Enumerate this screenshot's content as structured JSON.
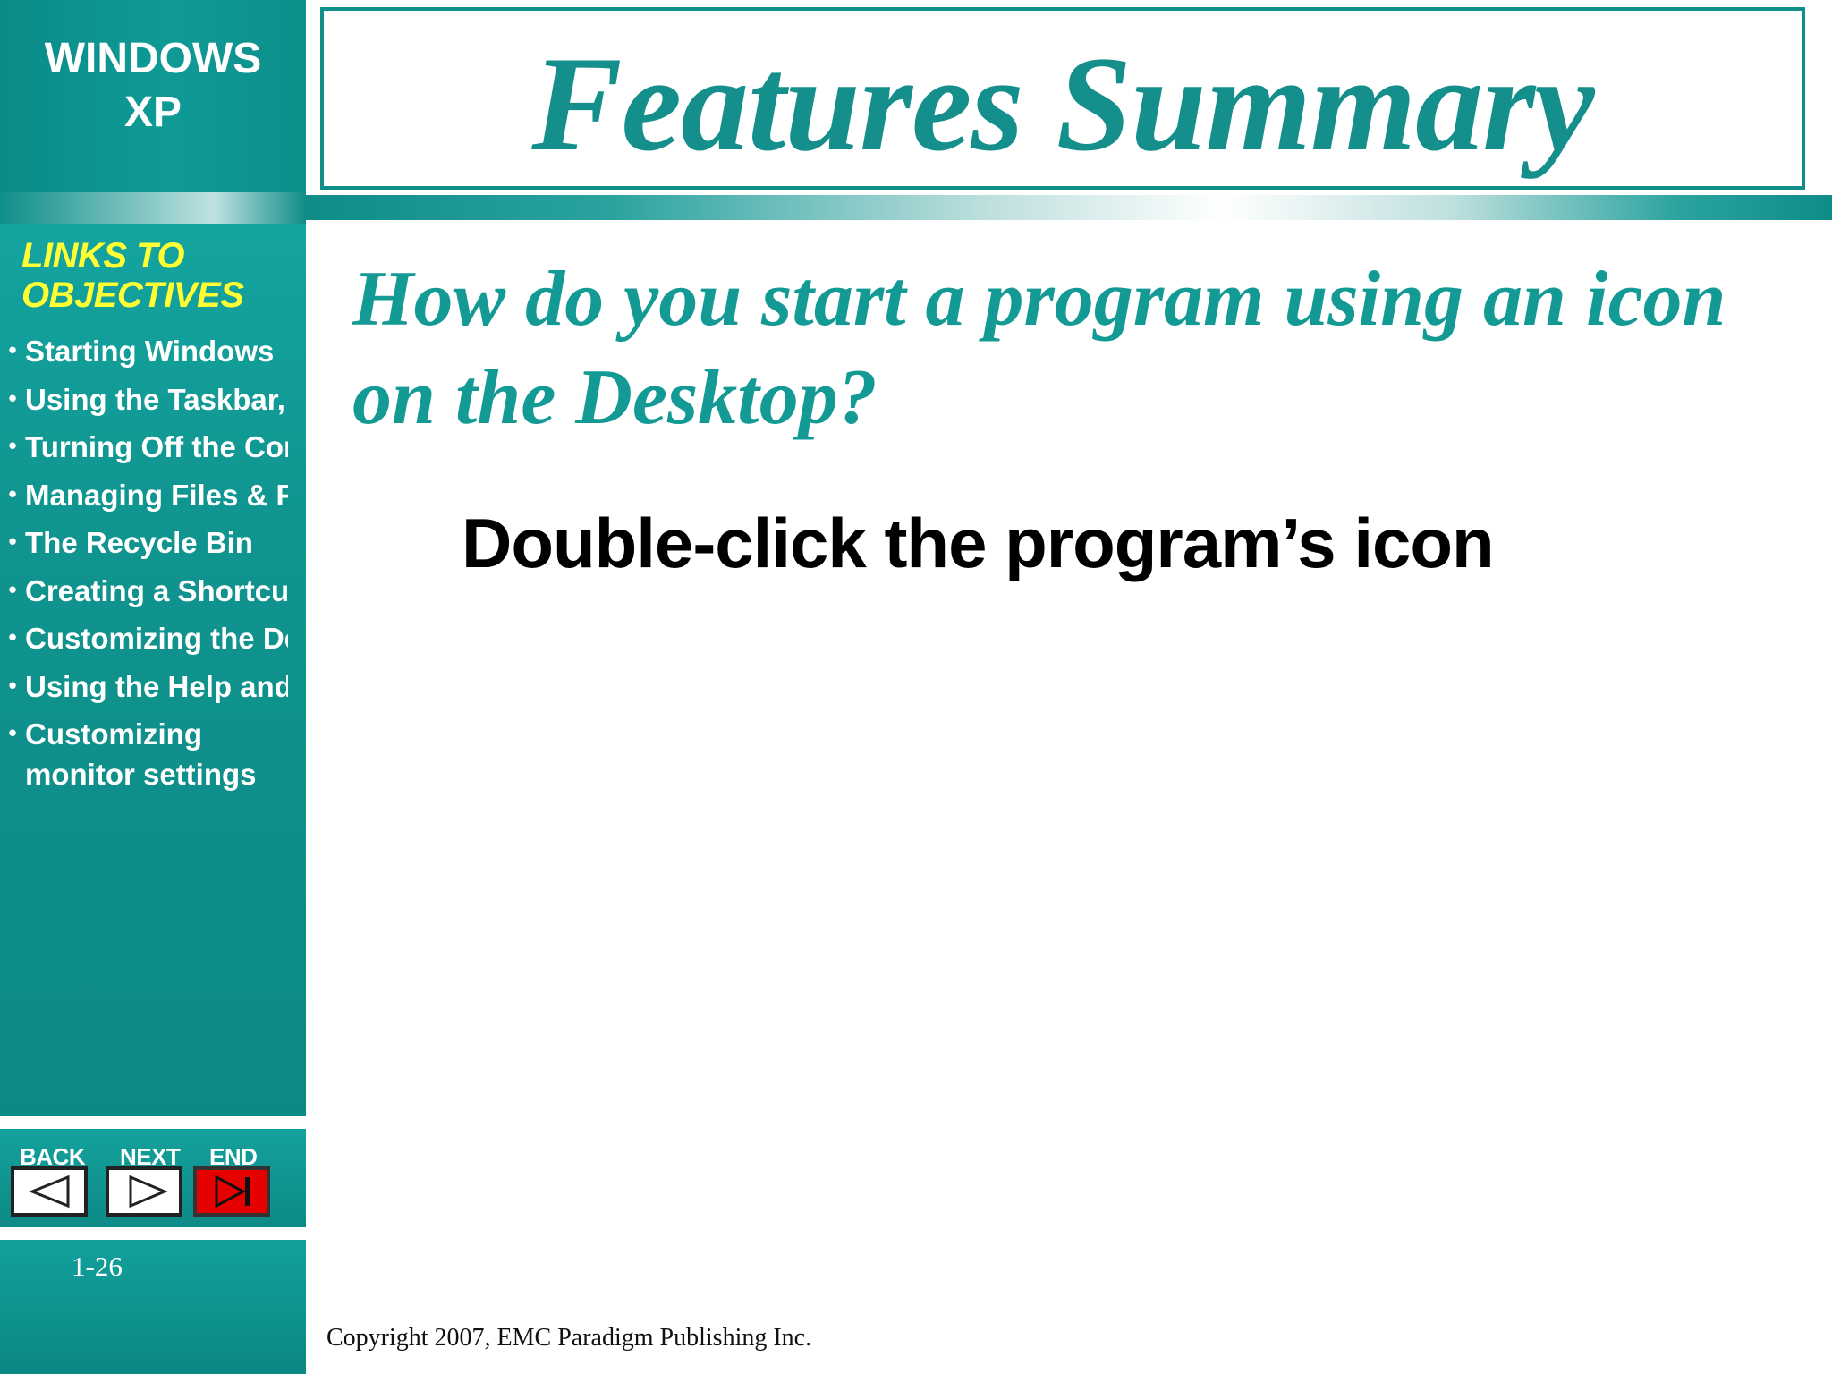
{
  "brand": {
    "line1": "WINDOWS",
    "line2": "XP"
  },
  "title": "Features Summary",
  "sidebar": {
    "heading_line1": "LINKS TO",
    "heading_line2": "OBJECTIVES",
    "items": [
      {
        "label": "Starting Windows"
      },
      {
        "label": "Using the Taskbar, o"
      },
      {
        "label": "Turning Off the Comp"
      },
      {
        "label": "Managing Files & Fol"
      },
      {
        "label": "The Recycle Bin"
      },
      {
        "label": "Creating a Shortcut"
      },
      {
        "label": "Customizing the Des"
      },
      {
        "label": "Using the Help and S"
      },
      {
        "label": "Customizing monitor settings"
      }
    ]
  },
  "nav": {
    "back_label": "BACK",
    "next_label": "NEXT",
    "end_label": "END"
  },
  "page_number": "1-26",
  "content": {
    "question": "How do you start a program using an icon on the Desktop?",
    "answer": "Double-click the program’s icon"
  },
  "footer": {
    "copyright": "Copyright 2007, EMC Paradigm Publishing Inc."
  },
  "colors": {
    "teal": "#0f9290",
    "title": "#148f8b",
    "link_heading": "#ffff33",
    "end_button": "#e60000"
  },
  "icons": {
    "back": "triangle-left-icon",
    "next": "triangle-right-icon",
    "end": "skip-end-icon"
  }
}
